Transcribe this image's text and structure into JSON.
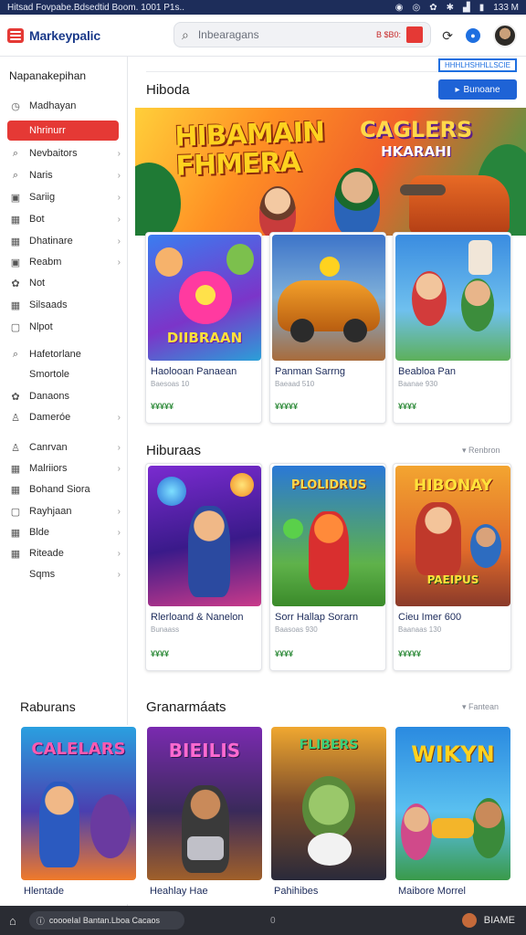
{
  "status_bar": {
    "text": "Hitsad Fovpabe.Bdsedtid Boom. 1001 P1s..",
    "time": "133 M"
  },
  "header": {
    "brand": "Markeypalic",
    "search_placeholder": "Inbearagans",
    "search_price": "B $B0:"
  },
  "sidebar": {
    "title": "Napanakepihan",
    "items": [
      {
        "label": "Madhayan",
        "icon": "clock-icon",
        "chevron": false
      },
      {
        "label": "Nhrinurr",
        "icon": "",
        "chevron": false,
        "active": true
      },
      {
        "label": "Nevbaitors",
        "icon": "search-icon",
        "chevron": true
      },
      {
        "label": "Naris",
        "icon": "search-icon",
        "chevron": true
      },
      {
        "label": "Sariig",
        "icon": "lock-icon",
        "chevron": true
      },
      {
        "label": "Bot",
        "icon": "grid-icon",
        "chevron": true
      },
      {
        "label": "Dhatinare",
        "icon": "grid-icon",
        "chevron": true
      },
      {
        "label": "Reabm",
        "icon": "lock-icon",
        "chevron": true
      },
      {
        "label": "Not",
        "icon": "gear-icon",
        "chevron": false
      },
      {
        "label": "Silsaads",
        "icon": "grid-icon",
        "chevron": false
      },
      {
        "label": "Nlpot",
        "icon": "square-icon",
        "chevron": false
      },
      {
        "label": "Hafetorlane",
        "icon": "search-icon",
        "chevron": false
      },
      {
        "label": "Smortole",
        "icon": "",
        "chevron": false
      },
      {
        "label": "Danaons",
        "icon": "gear-icon",
        "chevron": false
      },
      {
        "label": "Dameróe",
        "icon": "person-icon",
        "chevron": true
      },
      {
        "label": "Canrvan",
        "icon": "person-icon",
        "chevron": true
      },
      {
        "label": "Malriiors",
        "icon": "grid-icon",
        "chevron": true
      },
      {
        "label": "Bohand Siora",
        "icon": "grid-icon",
        "chevron": false
      },
      {
        "label": "Rayhjaan",
        "icon": "square-icon",
        "chevron": true
      },
      {
        "label": "Blde",
        "icon": "grid-icon",
        "chevron": true
      },
      {
        "label": "Riteade",
        "icon": "grid-icon",
        "chevron": true
      },
      {
        "label": "Sqms",
        "icon": "",
        "chevron": true
      }
    ]
  },
  "main": {
    "section1_title": "Hiboda",
    "filter_tag": "HHHLHSHHLLSCIE",
    "button_label": "Bunoane",
    "hero": {
      "title_line1": "HIBAMAIN",
      "title_line2": "FHMERA",
      "logo_line1": "CAGLERS",
      "logo_line2": "HKARAHI"
    },
    "row1": [
      {
        "title": "Haolooan Panaean",
        "sub": "Baesoas 10",
        "price": "¥¥¥¥¥",
        "thumb_text": "DIIBRAAN"
      },
      {
        "title": "Panman Sarrng",
        "sub": "Baeaad 510",
        "price": "¥¥¥¥¥",
        "thumb_text": ""
      },
      {
        "title": "Beabloa Pan",
        "sub": "Baanae 930",
        "price": "¥¥¥¥",
        "thumb_text": ""
      }
    ],
    "section2_title": "Hiburaas",
    "section2_see_all": "Renbron",
    "row2": [
      {
        "title": "Rlerloand & Nanelon",
        "sub": "Bunaass",
        "price": "¥¥¥¥",
        "thumb_text": ""
      },
      {
        "title": "Sorr Hallap Sorarn",
        "sub": "Baasoas 930",
        "price": "¥¥¥¥",
        "thumb_text": "PLOLIDRUS"
      },
      {
        "title": "Cieu Imer 600",
        "sub": "Baanaas 130",
        "price": "¥¥¥¥¥",
        "thumb_text": "HIBONAY"
      }
    ],
    "section3_left": "Raburans",
    "section3_title": "Granarmáats",
    "section3_see_all": "Fantean",
    "row3": [
      {
        "title": "Hlentade",
        "thumb_text": "CALELARS"
      },
      {
        "title": "Heahlay Hae",
        "thumb_text": "BIEILIS"
      },
      {
        "title": "Pahihibes",
        "thumb_text": "FLIBERS"
      },
      {
        "title": "Maibore Morrel",
        "thumb_text": "WIKYN"
      }
    ]
  },
  "bottom_bar": {
    "url": "coooeIaI Bantan.Lboa Cacaos",
    "dot": "0",
    "account": "BIAME"
  }
}
